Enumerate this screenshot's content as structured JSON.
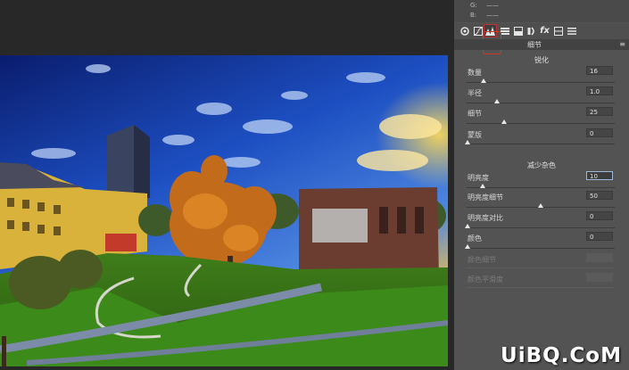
{
  "readout": {
    "g_label": "G:",
    "g_value": "——",
    "b_label": "B:",
    "b_value": "——"
  },
  "toolbar": {
    "tools": [
      "basic-tool-icon",
      "tone-curve-icon",
      "detail-icon",
      "hsl-icon",
      "split-toning-icon",
      "lens-correction-icon",
      "fx-icon",
      "camera-calibration-icon",
      "presets-icon"
    ],
    "selected": "detail-icon"
  },
  "section": {
    "title": "细节"
  },
  "sharpening": {
    "title": "锐化",
    "amount": {
      "label": "数量",
      "value": "16",
      "fraction": 0.11
    },
    "radius": {
      "label": "半径",
      "value": "1.0",
      "fraction": 0.2
    },
    "detail": {
      "label": "细节",
      "value": "25",
      "fraction": 0.25
    },
    "masking": {
      "label": "蒙版",
      "value": "0",
      "fraction": 0.0
    }
  },
  "noise_reduction": {
    "title": "减少杂色",
    "luminance": {
      "label": "明亮度",
      "value": "10",
      "fraction": 0.1
    },
    "luminance_detail": {
      "label": "明亮度细节",
      "value": "50",
      "fraction": 0.5
    },
    "luminance_contrast": {
      "label": "明亮度对比",
      "value": "0",
      "fraction": 0.0
    },
    "color": {
      "label": "颜色",
      "value": "0",
      "fraction": 0.0
    },
    "color_detail": {
      "label": "颜色细节"
    },
    "color_smoothness": {
      "label": "颜色平滑度"
    }
  },
  "watermark": "UiBQ.CoM",
  "colors": {
    "panel": "#535353",
    "canvas": "#282828",
    "accent": "#d23a2a"
  }
}
